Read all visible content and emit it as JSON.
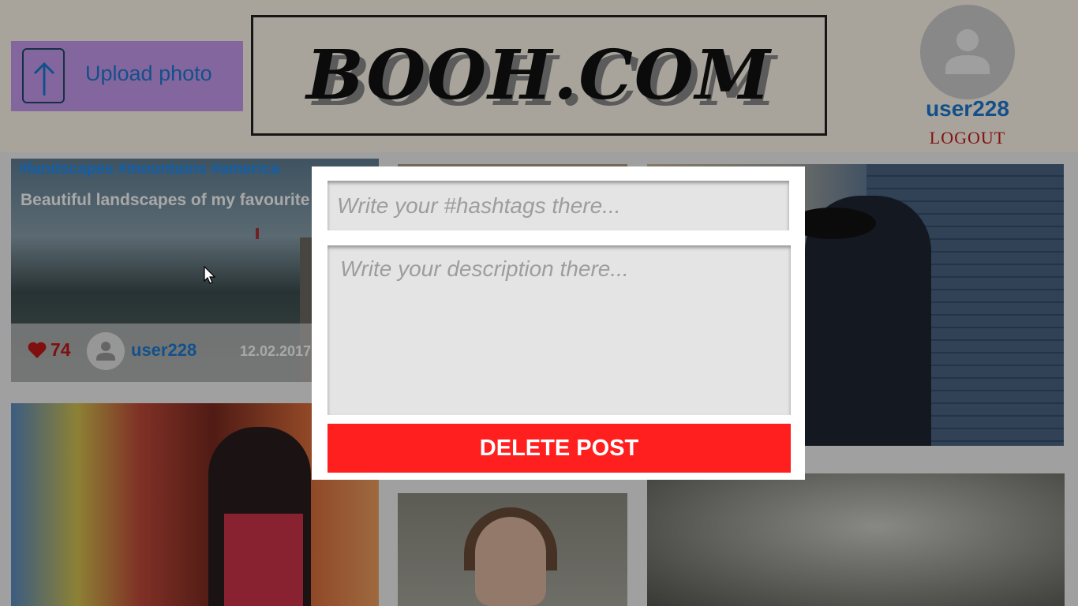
{
  "header": {
    "upload_label": "Upload photo",
    "logo_text": "BOOH.COM",
    "username": "user228",
    "logout_label": "LOGOUT"
  },
  "feed": {
    "post": {
      "hashtags": "#landscapes #mountains #america",
      "description": "Beautiful landscapes of my favourite America",
      "likes": "74",
      "author": "user228",
      "date": "12.02.2017"
    }
  },
  "modal": {
    "hashtags_placeholder": "Write your #hashtags there...",
    "description_placeholder": "Write your description there...",
    "delete_label": "DELETE POST"
  },
  "icons": {
    "upload": "upload-icon",
    "user_avatar": "user-avatar-icon",
    "heart": "heart-icon",
    "cursor": "mouse-cursor-icon"
  },
  "colors": {
    "upload_bg": "#c99bf0",
    "accent_blue": "#1e7ad4",
    "logout_red": "#c61c1c",
    "delete_red": "#ff1f1f",
    "header_bg": "#fff8eb"
  }
}
